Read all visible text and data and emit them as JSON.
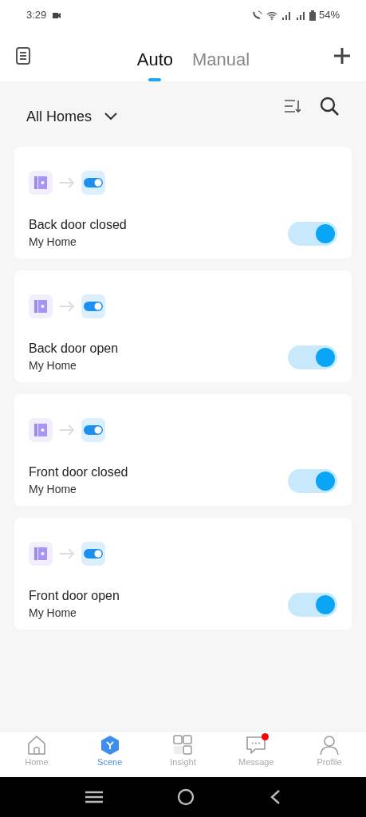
{
  "status_bar": {
    "time": "3:29",
    "battery": "54%"
  },
  "tabs": [
    {
      "label": "Auto",
      "selected": true
    },
    {
      "label": "Manual",
      "selected": false
    }
  ],
  "filter": {
    "label": "All Homes"
  },
  "scenes": [
    {
      "title": "Back door closed",
      "home": "My Home",
      "on": true
    },
    {
      "title": "Back door open",
      "home": "My Home",
      "on": true
    },
    {
      "title": "Front door closed",
      "home": "My Home",
      "on": true
    },
    {
      "title": "Front door open",
      "home": "My Home",
      "on": true
    }
  ],
  "bottom_nav": [
    {
      "kind": "home",
      "label": "Home",
      "selected": false,
      "badge": false
    },
    {
      "kind": "scene",
      "label": "Scene",
      "selected": true,
      "badge": false
    },
    {
      "kind": "insight",
      "label": "Insight",
      "selected": false,
      "badge": false
    },
    {
      "kind": "message",
      "label": "Message",
      "selected": false,
      "badge": true
    },
    {
      "kind": "profile",
      "label": "Profile",
      "selected": false,
      "badge": false
    }
  ]
}
